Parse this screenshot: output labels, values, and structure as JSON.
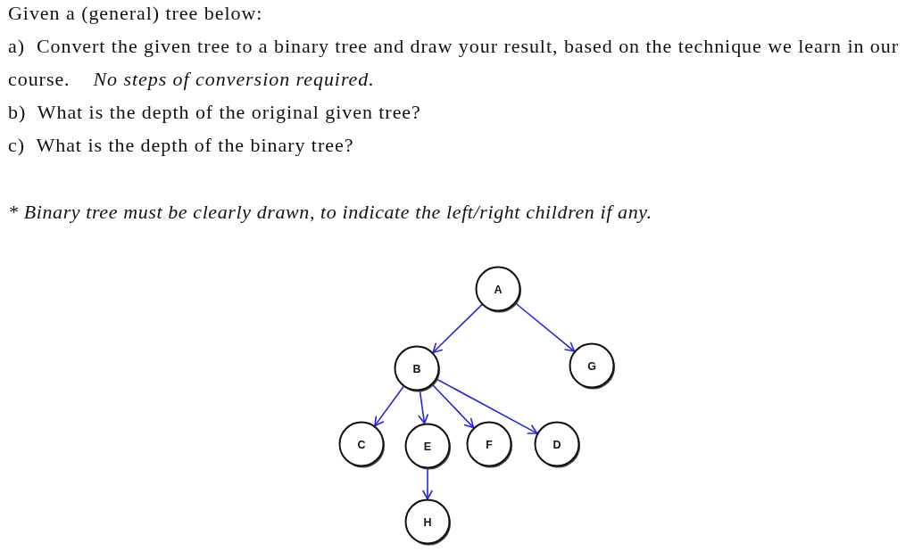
{
  "heading": "Given a (general) tree below:",
  "questions": [
    "a)  Convert the given tree to a binary tree and draw your result, based on the technique we learn in our course.    *No steps of conversion required.*",
    "b)  What is the depth of the original given tree?",
    "c)  What is the depth of the binary tree?"
  ],
  "note": "* Binary tree must be clearly drawn, to indicate the left/right children if any.",
  "tree": {
    "label": "A",
    "children": [
      {
        "label": "B",
        "children": [
          {
            "label": "C"
          },
          {
            "label": "E",
            "children": [
              {
                "label": "H"
              }
            ]
          },
          {
            "label": "F"
          },
          {
            "label": "D"
          }
        ]
      },
      {
        "label": "G"
      }
    ]
  }
}
